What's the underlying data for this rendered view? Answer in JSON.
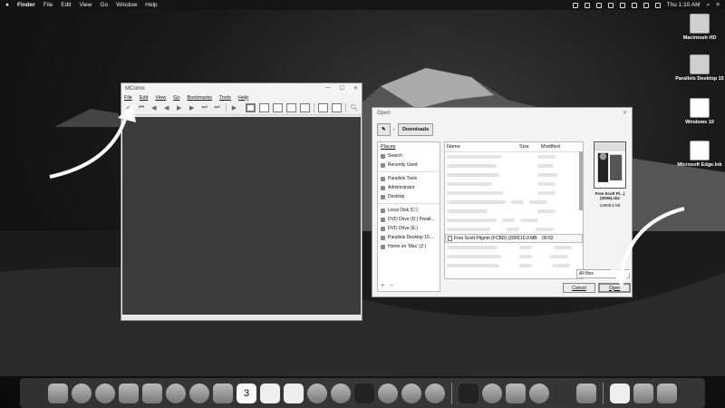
{
  "menubar": {
    "apple": "",
    "app": "Finder",
    "items": [
      "File",
      "Edit",
      "View",
      "Go",
      "Window",
      "Help"
    ],
    "clock": "Thu 1:10 AM"
  },
  "desktop_icons": [
    {
      "label": "Macintosh HD",
      "icon": "hard-drive-icon"
    },
    {
      "label": "Parallels Desktop 15",
      "icon": "hard-drive-icon"
    },
    {
      "label": "Windows 10",
      "icon": "windows-vm-icon"
    },
    {
      "label": "Microsoft Edge.lnk",
      "icon": "edge-icon"
    }
  ],
  "mcomix": {
    "title": "MComix",
    "menus": [
      "File",
      "Edit",
      "View",
      "Go",
      "Bookmarks",
      "Tools",
      "Help"
    ]
  },
  "open_dialog": {
    "title": "Open",
    "crumb": "Downloads",
    "places_header": "Places",
    "places": [
      "Search",
      "Recently Used",
      "Parallels Tools",
      "Administrator",
      "Desktop",
      "Local Disk (C:)",
      "DVD Drive (D:) Parall...",
      "DVD Drive (E:)",
      "Parallels Desktop 15...",
      "Home on 'Mac' (Z:)"
    ],
    "columns": {
      "name": "Name",
      "size": "Size",
      "modified": "Modified"
    },
    "selected_file": {
      "name": "Free Scott Pilgrim (FCBD) (2006)...",
      "size": "10.9 MB",
      "modified": "00:52"
    },
    "preview_name": "Free Scott Pi...) (2006).cbz",
    "preview_size": "10905.5 kB",
    "filter": "All files",
    "cancel": "Cancel",
    "open": "Open",
    "add": "+",
    "remove": "−"
  },
  "dock": {
    "badge": "3"
  }
}
